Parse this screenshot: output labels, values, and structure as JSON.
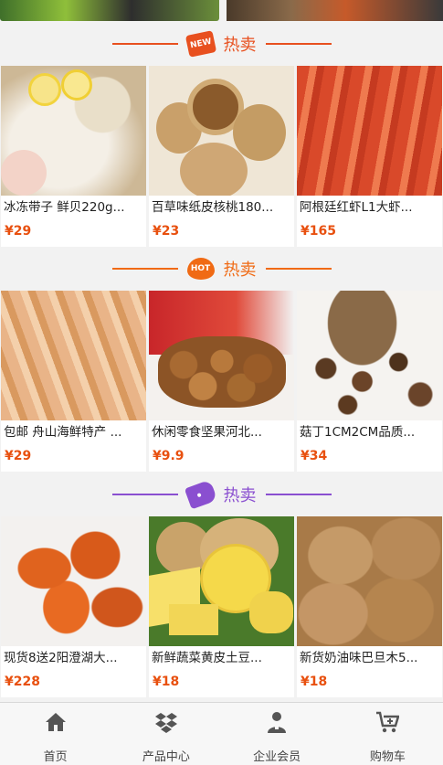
{
  "colors": {
    "price": "#e8500f",
    "section1_accent": "#e8501f",
    "section2_accent": "#f06a14",
    "section3_accent": "#8a4fd0"
  },
  "sections": [
    {
      "title": "热卖",
      "badge": "NEW",
      "icon": "new-badge-icon",
      "products": [
        {
          "name": "冰冻带子 鲜贝220g...",
          "price": "¥29",
          "image": "scallops"
        },
        {
          "name": "百草味纸皮核桃180...",
          "price": "¥23",
          "image": "walnuts"
        },
        {
          "name": "阿根廷红虾L1大虾...",
          "price": "¥165",
          "image": "shrimp"
        }
      ]
    },
    {
      "title": "热卖",
      "badge": "HOT",
      "icon": "hot-flame-icon",
      "products": [
        {
          "name": "包邮 舟山海鲜特产 ...",
          "price": "¥29",
          "image": "dried-squid"
        },
        {
          "name": "休闲零食坚果河北...",
          "price": "¥9.9",
          "image": "chestnuts"
        },
        {
          "name": "菇丁1CM2CM品质...",
          "price": "¥34",
          "image": "mushrooms"
        }
      ]
    },
    {
      "title": "热卖",
      "badge": "",
      "icon": "tag-icon",
      "products": [
        {
          "name": "现货8送2阳澄湖大...",
          "price": "¥228",
          "image": "crabs"
        },
        {
          "name": "新鲜蔬菜黄皮土豆...",
          "price": "¥18",
          "image": "potatoes"
        },
        {
          "name": "新货奶油味巴旦木5...",
          "price": "¥18",
          "image": "almonds"
        }
      ]
    }
  ],
  "tabbar": [
    {
      "label": "首页",
      "icon": "home-icon"
    },
    {
      "label": "产品中心",
      "icon": "dropbox-icon"
    },
    {
      "label": "企业会员",
      "icon": "member-icon"
    },
    {
      "label": "购物车",
      "icon": "cart-icon"
    }
  ]
}
